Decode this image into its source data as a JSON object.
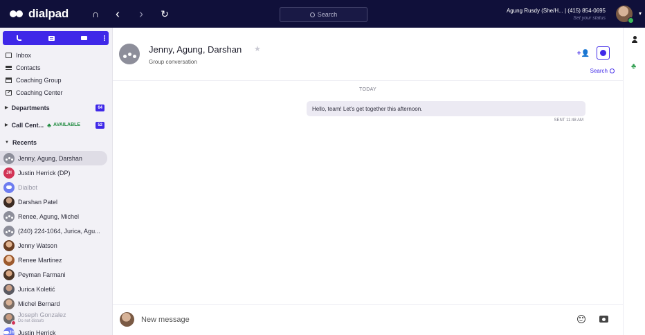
{
  "app": {
    "logo_text": "dialpad",
    "search_placeholder": "Search",
    "user_name": "Agung Rusdy (She/H... | (415) 854-0695",
    "user_status": "Set your status",
    "nav_back": "‹",
    "nav_forward": "›",
    "nav_refresh": "↻",
    "headset": "∩",
    "menu_caret": "▾"
  },
  "sidebar": {
    "nav": [
      {
        "label": "Inbox",
        "icon": "inbox-icon"
      },
      {
        "label": "Contacts",
        "icon": "contacts-icon"
      },
      {
        "label": "Coaching Group",
        "icon": "coaching-group-icon"
      },
      {
        "label": "Coaching Center",
        "icon": "coaching-center-icon"
      }
    ],
    "departments": {
      "label": "Departments",
      "badge": "64"
    },
    "call_center": {
      "label": "Call Cent...",
      "status": "AVAILABLE",
      "badge": "52"
    },
    "recents_label": "Recents",
    "recents": [
      {
        "name": "Jenny, Agung, Darshan"
      },
      {
        "name": "Justin Herrick (DP)",
        "initials": "JH"
      },
      {
        "name": "Dialbot"
      },
      {
        "name": "Darshan Patel"
      },
      {
        "name": "Renee, Agung, Michel"
      },
      {
        "name": "(240) 224-1064, Jurica, Agu..."
      },
      {
        "name": "Jenny Watson"
      },
      {
        "name": "Renee Martinez"
      },
      {
        "name": "Peyman Farmani"
      },
      {
        "name": "Jurica Koletić"
      },
      {
        "name": "Michel Bernard"
      },
      {
        "name": "Joseph Gonzalez",
        "subtitle": "Do not disturb"
      },
      {
        "name": "Justin Herrick",
        "initials": "JH"
      }
    ]
  },
  "conversation": {
    "title": "Jenny, Agung, Darshan",
    "subtitle": "Group conversation",
    "search_label": "Search",
    "day_separator": "TODAY",
    "messages": [
      {
        "text": "Hello, team! Let's get together this afternoon.",
        "meta": "SENT 11:48 AM"
      }
    ],
    "composer_placeholder": "New message"
  },
  "colors": {
    "topbar": "#10103a",
    "accent": "#3f28e8",
    "available": "#1e8a3e",
    "sidebar_bg": "#f2f1f6"
  }
}
